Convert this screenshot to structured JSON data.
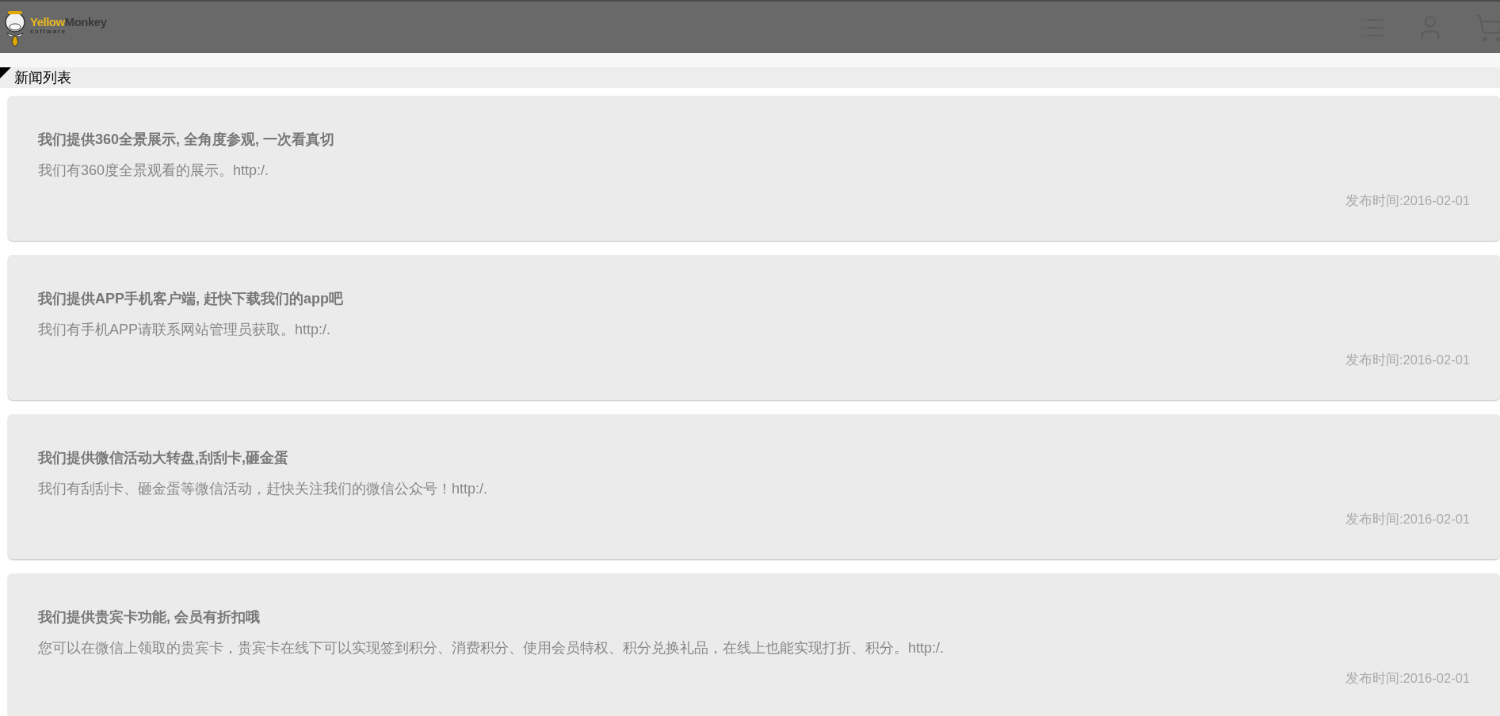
{
  "header": {
    "logo": {
      "brand_part_1": "Yellow",
      "brand_part_2": "Monkey",
      "tagline": "software"
    }
  },
  "section": {
    "title": "新闻列表"
  },
  "news": [
    {
      "title": "我们提供360全景展示, 全角度参观, 一次看真切",
      "summary": "我们有360度全景观看的展示。http:/.",
      "date": "发布时间:2016-02-01"
    },
    {
      "title": "我们提供APP手机客户端, 赶快下载我们的app吧",
      "summary": "我们有手机APP请联系网站管理员获取。http:/.",
      "date": "发布时间:2016-02-01"
    },
    {
      "title": "我们提供微信活动大转盘,刮刮卡,砸金蛋",
      "summary": "我们有刮刮卡、砸金蛋等微信活动，赶快关注我们的微信公众号！http:/.",
      "date": "发布时间:2016-02-01"
    },
    {
      "title": "我们提供贵宾卡功能, 会员有折扣哦",
      "summary": "您可以在微信上领取的贵宾卡，贵宾卡在线下可以实现签到积分、消费积分、使用会员特权、积分兑换礼品，在线上也能实现打折、积分。http:/.",
      "date": "发布时间:2016-02-01"
    }
  ]
}
